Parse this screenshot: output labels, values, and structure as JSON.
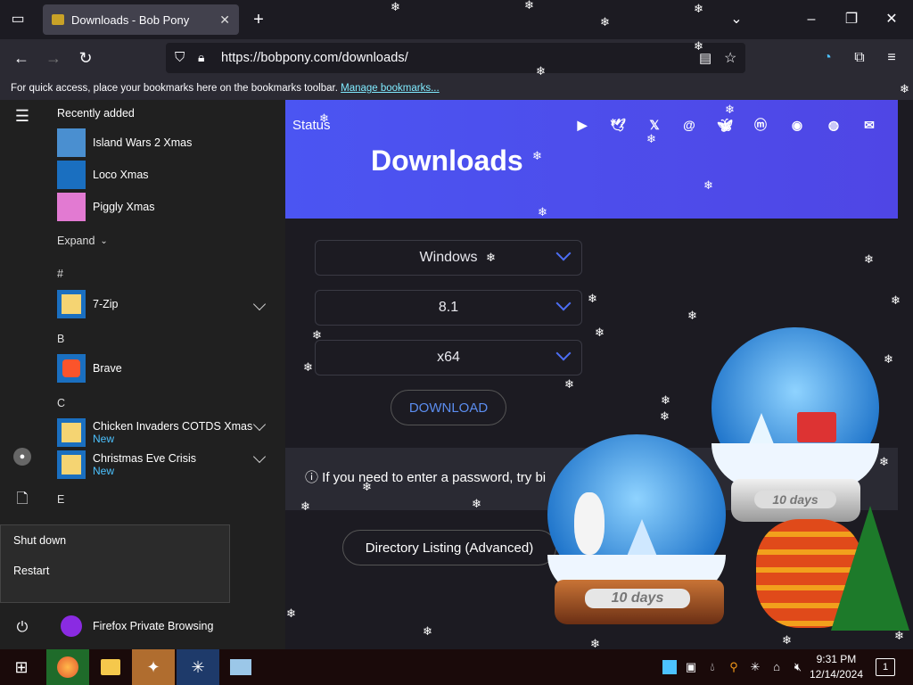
{
  "browser": {
    "tab_title": "Downloads - Bob Pony",
    "url": "https://bobpony.com/downloads/",
    "bookmarks_text": "For quick access, place your bookmarks here on the bookmarks toolbar.",
    "manage_bookmarks": "Manage bookmarks..."
  },
  "page": {
    "status_link": "Status",
    "title": "Downloads",
    "social_icons": [
      "youtube-icon",
      "twitter-icon",
      "x-icon",
      "threads-icon",
      "bluesky-icon",
      "mastodon-icon",
      "discord-icon",
      "github-icon",
      "email-icon"
    ],
    "os_select": "Windows",
    "version_select": "8.1",
    "arch_select": "x64",
    "download_button": "DOWNLOAD",
    "info_text": "If you need to enter a password, try bi",
    "directory_button": "Directory Listing (Advanced)",
    "globe_left_label": "10 days",
    "globe_right_label": "10 days",
    "accent_color": "#4f46e5"
  },
  "start_menu": {
    "recently_added": "Recently added",
    "recent_apps": [
      {
        "name": "Island Wars 2 Xmas"
      },
      {
        "name": "Loco Xmas"
      },
      {
        "name": "Piggly Xmas"
      }
    ],
    "expand": "Expand",
    "sections": [
      {
        "letter": "#",
        "apps": [
          {
            "name": "7-Zip",
            "badge": ""
          }
        ]
      },
      {
        "letter": "B",
        "apps": [
          {
            "name": "Brave",
            "badge": ""
          }
        ]
      },
      {
        "letter": "C",
        "apps": [
          {
            "name": "Chicken Invaders COTDS Xmas",
            "badge": "New"
          },
          {
            "name": "Christmas Eve Crisis",
            "badge": "New"
          }
        ]
      },
      {
        "letter": "E",
        "apps": []
      }
    ],
    "power_menu": [
      "Shut down",
      "Restart"
    ],
    "bottom_app": "Firefox Private Browsing"
  },
  "taskbar": {
    "time": "9:31 PM",
    "date": "12/14/2024",
    "notification_count": "1"
  }
}
